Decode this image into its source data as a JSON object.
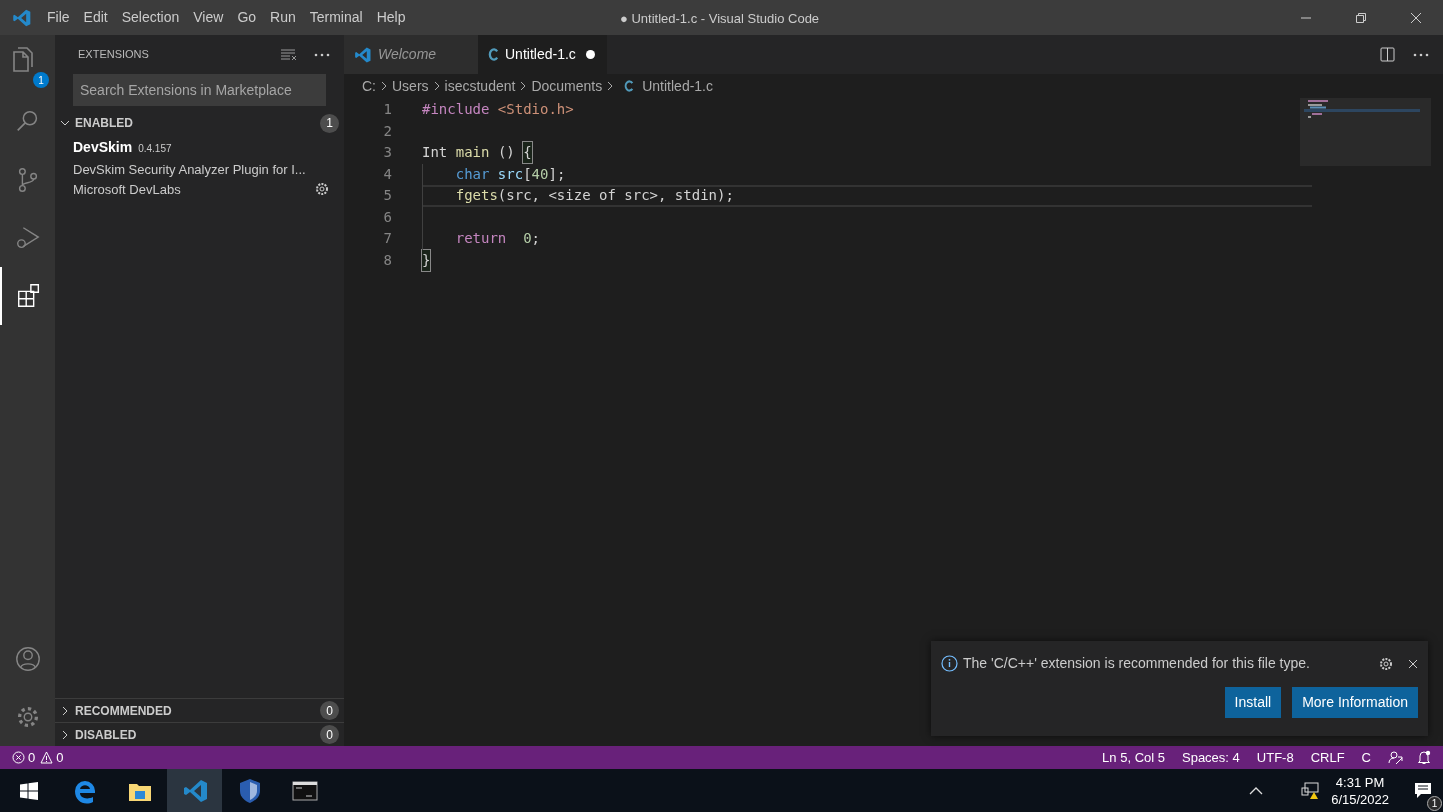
{
  "window": {
    "title": "● Untitled-1.c - Visual Studio Code"
  },
  "menu": [
    "File",
    "Edit",
    "Selection",
    "View",
    "Go",
    "Run",
    "Terminal",
    "Help"
  ],
  "activity_bar": {
    "top": [
      {
        "kind": "files",
        "selected": false,
        "badge": "1"
      },
      {
        "kind": "search",
        "selected": false
      },
      {
        "kind": "source-control",
        "selected": false
      },
      {
        "kind": "run",
        "selected": false
      },
      {
        "kind": "extensions",
        "selected": true
      }
    ],
    "bottom": [
      {
        "kind": "account"
      },
      {
        "kind": "settings"
      }
    ]
  },
  "sidebar": {
    "title": "EXTENSIONS",
    "search": {
      "placeholder": "Search Extensions in Marketplace"
    },
    "sections": [
      {
        "label": "ENABLED",
        "count": "1",
        "expanded": true,
        "items": [
          {
            "name": "DevSkim",
            "version": "0.4.157",
            "description": "DevSkim Security Analyzer Plugin for I...",
            "publisher": "Microsoft DevLabs"
          }
        ]
      },
      {
        "label": "RECOMMENDED",
        "count": "0",
        "expanded": false
      },
      {
        "label": "DISABLED",
        "count": "0",
        "expanded": false
      }
    ]
  },
  "tabs": [
    {
      "label": "Welcome",
      "kind": "welcome",
      "selected": false,
      "dirty": false
    },
    {
      "label": "Untitled-1.c",
      "kind": "c",
      "selected": true,
      "dirty": true
    }
  ],
  "breadcrumbs": [
    "C:",
    "Users",
    "isecstudent",
    "Documents",
    "Untitled-1.c"
  ],
  "code": [
    {
      "number": "1",
      "tokens": [
        {
          "text": "#include",
          "kind": "keyword"
        },
        {
          "text": " <Stdio.h>",
          "kind": "string"
        }
      ]
    },
    {
      "number": "2"
    },
    {
      "number": "3",
      "tokens": [
        {
          "text": "Int",
          "kind": "plain"
        },
        {
          "text": " main",
          "kind": "function"
        },
        {
          "text": " () ",
          "kind": "plain"
        },
        {
          "text": "{",
          "kind": "bracket-match"
        }
      ]
    },
    {
      "number": "4",
      "tokens": [
        {
          "text": "    char",
          "kind": "type"
        },
        {
          "text": " src",
          "kind": "variable"
        },
        {
          "text": "[",
          "kind": "plain"
        },
        {
          "text": "40",
          "kind": "number"
        },
        {
          "text": "];",
          "kind": "plain"
        }
      ]
    },
    {
      "number": "5",
      "current": true,
      "tokens": [
        {
          "text": "    fgets",
          "kind": "function"
        },
        {
          "text": "(src, <size of src>, stdin);",
          "kind": "plain"
        }
      ]
    },
    {
      "number": "6"
    },
    {
      "number": "7",
      "tokens": [
        {
          "text": "    return",
          "kind": "keyword"
        },
        {
          "text": "  0",
          "kind": "number"
        },
        {
          "text": ";",
          "kind": "plain"
        }
      ]
    },
    {
      "number": "8",
      "tokens": [
        {
          "text": "}",
          "kind": "bracket-match"
        }
      ]
    }
  ],
  "notification": {
    "message": "The 'C/C++' extension is recommended for this file type.",
    "buttons": [
      "Install",
      "More Information"
    ]
  },
  "status_bar": {
    "errors": "0",
    "warnings": "0",
    "items": [
      "Ln 5, Col 5",
      "Spaces: 4",
      "UTF-8",
      "CRLF",
      "C"
    ]
  },
  "taskbar": {
    "apps": [
      {
        "kind": "edge",
        "selected": false
      },
      {
        "kind": "folder",
        "selected": false
      },
      {
        "kind": "vscode",
        "selected": true
      },
      {
        "kind": "shield",
        "selected": false
      },
      {
        "kind": "terminal",
        "selected": false
      }
    ],
    "time": "4:31 PM",
    "date": "6/15/2022",
    "notification_count": "1"
  }
}
